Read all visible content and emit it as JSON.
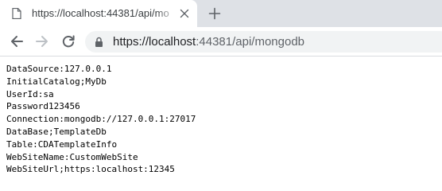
{
  "tab": {
    "title": "https://localhost:44381/api/mo",
    "favicon": "page-icon",
    "close_icon": "close-icon"
  },
  "new_tab_icon": "plus-icon",
  "toolbar": {
    "back_icon": "arrow-left-icon",
    "forward_icon": "arrow-right-icon",
    "reload_icon": "reload-icon",
    "lock_icon": "lock-icon",
    "url_host": "https://localhost",
    "url_rest": ":44381/api/mongodb"
  },
  "content": {
    "lines": [
      "DataSource:127.0.0.1",
      "InitialCatalog;MyDb",
      "UserId:sa",
      "Password123456",
      "Connection:mongodb://127.0.0.1:27017",
      "DataBase;TemplateDb",
      "Table:CDATemplateInfo",
      "WebSiteName:CustomWebSite",
      "WebSiteUrl;https:localhost:12345"
    ]
  },
  "colors": {
    "tabstrip": "#dee1e6",
    "omnibox": "#f1f3f4",
    "icon": "#5f6368",
    "icon_disabled": "#bdc1c6"
  }
}
